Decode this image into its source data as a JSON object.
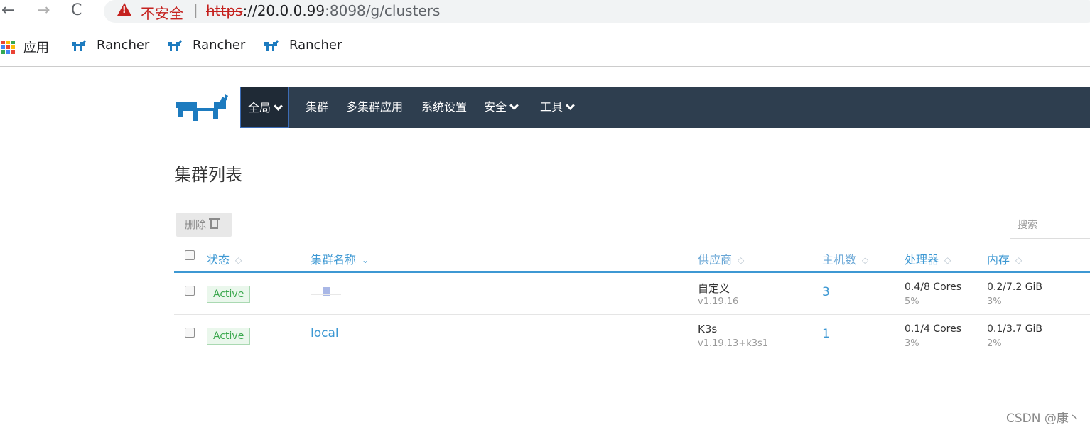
{
  "browser": {
    "insecure_label": "不安全",
    "separator": "|",
    "url_scheme": "https",
    "url_host": "://20.0.0.99",
    "url_rest": ":8098/g/clusters",
    "bookmarks": [
      "应用",
      "Rancher",
      "Rancher",
      "Rancher"
    ]
  },
  "nav": {
    "global": "全局",
    "clusters": "集群",
    "multi_cluster_apps": "多集群应用",
    "settings": "系统设置",
    "security": "安全",
    "tools": "工具"
  },
  "page": {
    "title": "集群列表",
    "delete_label": "删除",
    "search_placeholder": "搜索"
  },
  "table": {
    "headers": {
      "state": "状态",
      "name": "集群名称",
      "provider": "供应商",
      "nodes": "主机数",
      "cpu": "处理器",
      "memory": "内存"
    },
    "rows": [
      {
        "state": "Active",
        "name": "",
        "provider": "自定义",
        "version": "v1.19.16",
        "nodes": "3",
        "cpu": "0.4/8 Cores",
        "cpu_pct": "5%",
        "memory": "0.2/7.2 GiB",
        "memory_pct": "3%"
      },
      {
        "state": "Active",
        "name": "local",
        "provider": "K3s",
        "version": "v1.19.13+k3s1",
        "nodes": "1",
        "cpu": "0.1/4 Cores",
        "cpu_pct": "3%",
        "memory": "0.1/3.7 GiB",
        "memory_pct": "2%"
      }
    ]
  },
  "watermark": "CSDN @康丶",
  "colors": {
    "navbar": "#2e3e4f",
    "accent": "#3d98d3",
    "active_green": "#3ba84e",
    "insecure_red": "#c5221f"
  }
}
